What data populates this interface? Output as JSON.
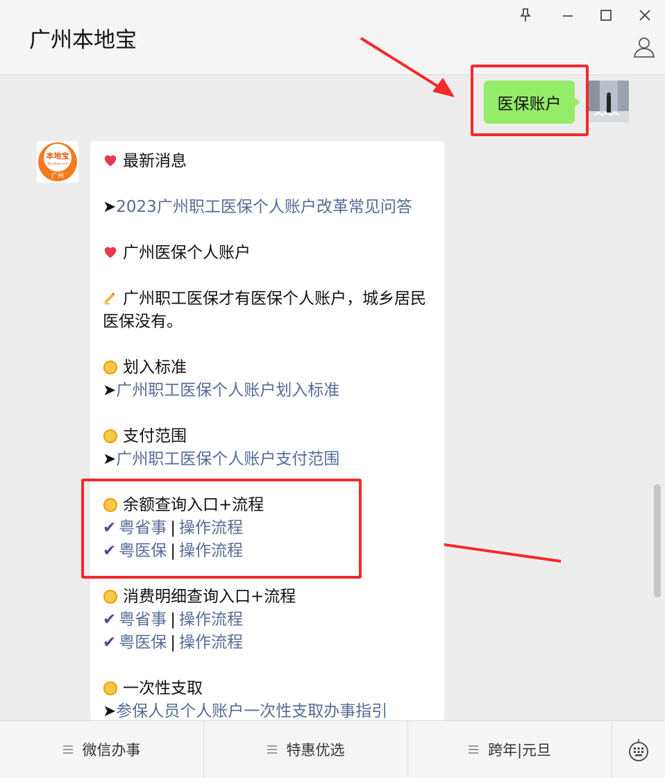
{
  "window": {
    "title": "广州本地宝"
  },
  "outgoing": {
    "text": "医保账户"
  },
  "message": {
    "header_latest": "最新消息",
    "link_faq": "2023广州职工医保个人账户改革常见问答",
    "section_account": "广州医保个人账户",
    "note_text": "广州职工医保才有医保个人账户，城乡居民医保没有。",
    "sec_standard": "划入标准",
    "link_standard": "广州职工医保个人账户划入标准",
    "sec_payment": "支付范围",
    "link_payment": "广州职工医保个人账户支付范围",
    "sec_balance": "余额查询入口+流程",
    "balance_app1": "粤省事",
    "balance_app1_flow": "操作流程",
    "balance_app2": "粤医保",
    "balance_app2_flow": "操作流程",
    "sec_detail": "消费明细查询入口+流程",
    "detail_app1": "粤省事",
    "detail_app1_flow": "操作流程",
    "detail_app2": "粤医保",
    "detail_app2_flow": "操作流程",
    "sec_withdraw": "一次性支取",
    "link_withdraw": "参保人员个人账户一次性支取办事指引",
    "arrow_glyph": "➤",
    "pipe": "|"
  },
  "avatar": {
    "line1": "本地宝",
    "line2": "Bendibao.com",
    "line3": "广州"
  },
  "bottom_menu": [
    {
      "label": "微信办事"
    },
    {
      "label": "特惠优选"
    },
    {
      "label": "跨年|元旦"
    }
  ],
  "colors": {
    "link": "#576b95",
    "bubble_out": "#95ec69",
    "highlight": "#f3292b"
  },
  "icons": [
    "pin-icon",
    "minimize-icon",
    "maximize-icon",
    "close-icon",
    "person-icon",
    "heart-icon",
    "writing-hand-icon",
    "sun-icon",
    "check-icon",
    "menu-lines-icon",
    "keyboard-icon"
  ]
}
